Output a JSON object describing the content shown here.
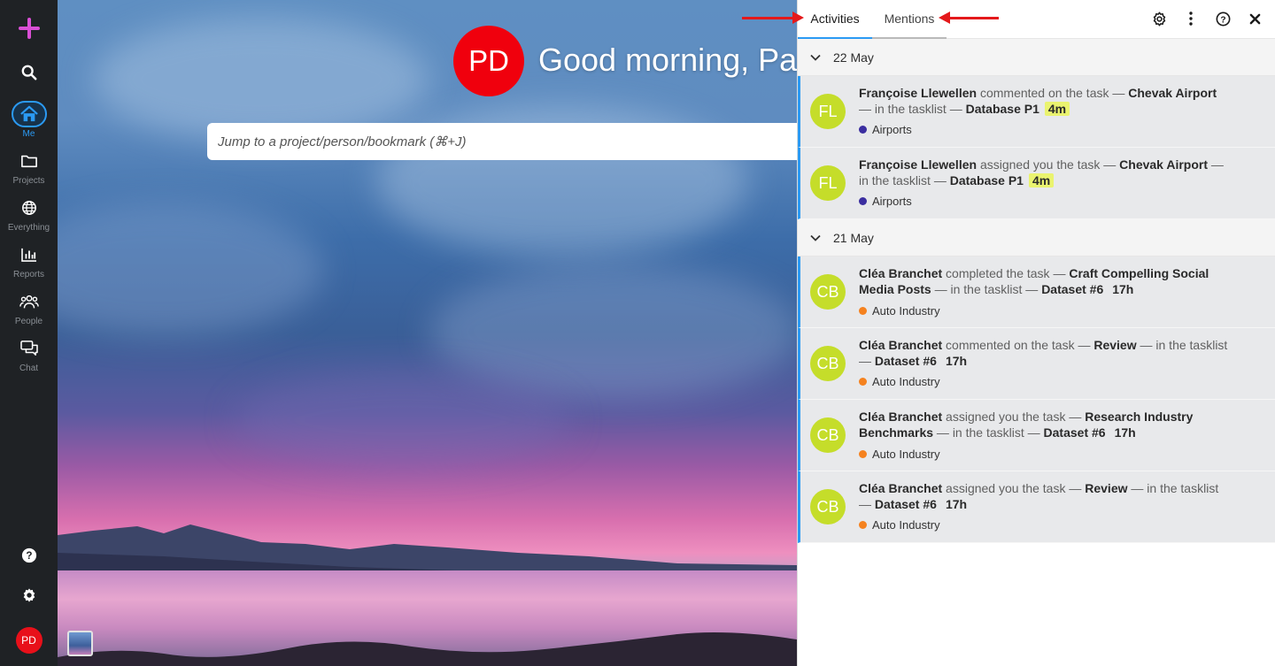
{
  "sidebar": {
    "items": [
      {
        "label": "Me",
        "icon": "home-icon"
      },
      {
        "label": "Projects",
        "icon": "folder-icon"
      },
      {
        "label": "Everything",
        "icon": "globe-icon"
      },
      {
        "label": "Reports",
        "icon": "bar-chart-icon"
      },
      {
        "label": "People",
        "icon": "people-icon"
      },
      {
        "label": "Chat",
        "icon": "chat-icon"
      }
    ],
    "user_initials": "PD",
    "accent": "#2b9af3",
    "plus_color": "#d94fd5"
  },
  "home": {
    "avatar_initials": "PD",
    "greeting": "Good morning, Pau",
    "jump_placeholder": "Jump to a project/person/bookmark (⌘+J)"
  },
  "panel": {
    "tabs": [
      {
        "label": "Activities",
        "active": true
      },
      {
        "label": "Mentions",
        "active": false
      }
    ],
    "groups": [
      {
        "date": "22 May",
        "items": [
          {
            "initials": "FL",
            "actor": "Françoise Llewellen",
            "action": "commented on the task",
            "sep1": " — ",
            "task": "Chevak Airport",
            "sep2": " — in the tasklist — ",
            "list": "Database P1",
            "time": "4m",
            "project": "Airports",
            "project_color": "#3b2ea0"
          },
          {
            "initials": "FL",
            "actor": "Françoise Llewellen",
            "action": "assigned you the task",
            "sep1": " — ",
            "task": "Chevak Airport",
            "sep2": " — in the tasklist — ",
            "list": "Database P1",
            "time": "4m",
            "project": "Airports",
            "project_color": "#3b2ea0"
          }
        ]
      },
      {
        "date": "21 May",
        "items": [
          {
            "initials": "CB",
            "actor": "Cléa Branchet",
            "action": "completed the task",
            "sep1": " — ",
            "task": "Craft Compelling Social Media Posts",
            "sep2": " — in the tasklist — ",
            "list": "Dataset #6",
            "time": "17h",
            "project": "Auto Industry",
            "project_color": "#f5821f"
          },
          {
            "initials": "CB",
            "actor": "Cléa Branchet",
            "action": "commented on the task",
            "sep1": " — ",
            "task": "Review",
            "sep2": " — in the tasklist — ",
            "list": "Dataset #6",
            "time": "17h",
            "project": "Auto Industry",
            "project_color": "#f5821f"
          },
          {
            "initials": "CB",
            "actor": "Cléa Branchet",
            "action": "assigned you the task",
            "sep1": " — ",
            "task": "Research Industry Benchmarks",
            "sep2": " — in the tasklist — ",
            "list": "Dataset #6",
            "time": "17h",
            "project": "Auto Industry",
            "project_color": "#f5821f"
          },
          {
            "initials": "CB",
            "actor": "Cléa Branchet",
            "action": "assigned you the task",
            "sep1": " — ",
            "task": "Review",
            "sep2": " — in the tasklist — ",
            "list": "Dataset #6",
            "time": "17h",
            "project": "Auto Industry",
            "project_color": "#f5821f"
          }
        ]
      }
    ]
  }
}
